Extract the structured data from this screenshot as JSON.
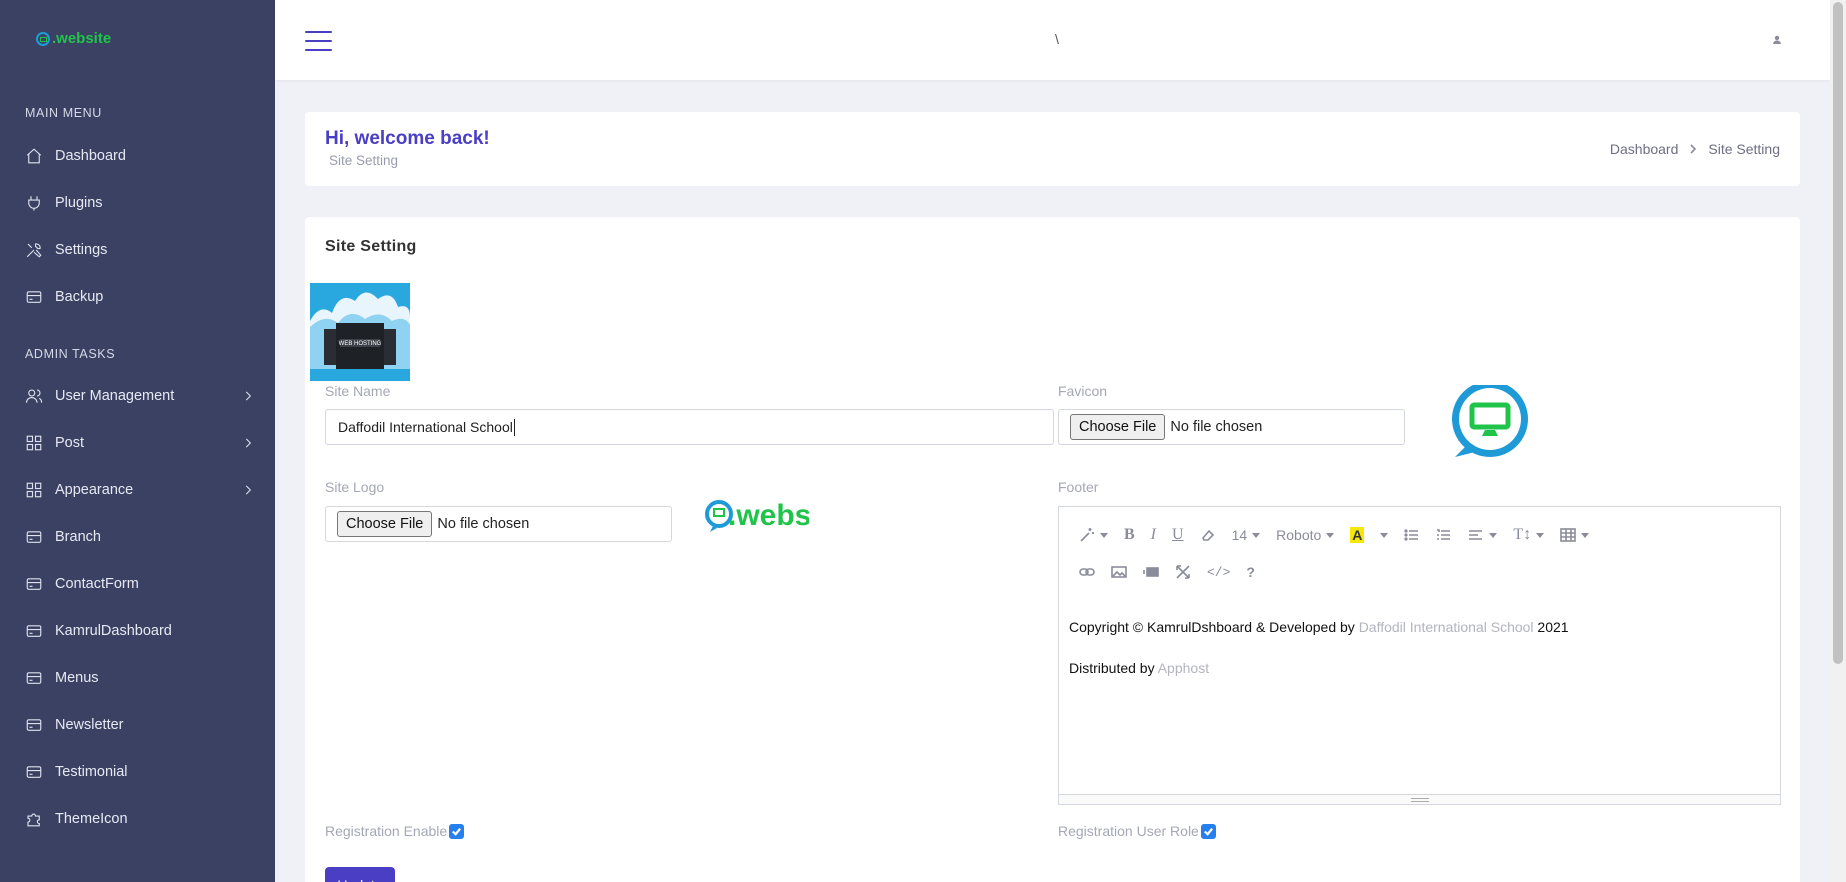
{
  "brand": {
    "name": ".website",
    "accent": "#21c44a"
  },
  "sidebar": {
    "main_heading": "MAIN MENU",
    "main_items": [
      {
        "label": "Dashboard",
        "icon": "home-icon"
      },
      {
        "label": "Plugins",
        "icon": "plug-icon"
      },
      {
        "label": "Settings",
        "icon": "tools-icon"
      },
      {
        "label": "Backup",
        "icon": "card-icon"
      }
    ],
    "admin_heading": "ADMIN TASKS",
    "admin_items": [
      {
        "label": "User Management",
        "icon": "users-icon",
        "expandable": true
      },
      {
        "label": "Post",
        "icon": "grid-icon",
        "expandable": true
      },
      {
        "label": "Appearance",
        "icon": "grid-icon",
        "expandable": true
      },
      {
        "label": "Branch",
        "icon": "card-icon"
      },
      {
        "label": "ContactForm",
        "icon": "card-icon"
      },
      {
        "label": "KamrulDashboard",
        "icon": "card-icon"
      },
      {
        "label": "Menus",
        "icon": "card-icon"
      },
      {
        "label": "Newsletter",
        "icon": "card-icon"
      },
      {
        "label": "Testimonial",
        "icon": "card-icon"
      },
      {
        "label": "ThemeIcon",
        "icon": "puzzle-icon"
      }
    ]
  },
  "topbar": {
    "center_text": "\\"
  },
  "header": {
    "welcome": "Hi, welcome back!",
    "subtitle": "Site Setting",
    "breadcrumb": [
      "Dashboard",
      "Site Setting"
    ]
  },
  "form": {
    "title": "Site Setting",
    "site_name_label": "Site Name",
    "site_name_value": "Daffodil International School",
    "favicon_label": "Favicon",
    "site_logo_label": "Site Logo",
    "file_button": "Choose File",
    "file_status": "No file chosen",
    "footer_label": "Footer",
    "footer_font_size": "14",
    "footer_font_name": "Roboto",
    "footer_line1_prefix": "Copyright © KamrulDshboard & Developed by ",
    "footer_line1_link": "Daffodil International School",
    "footer_line1_suffix": " 2021",
    "footer_line2_prefix": "Distributed by ",
    "footer_line2_link": "Apphost",
    "registration_enable_label": "Registration Enable",
    "registration_enable_checked": true,
    "registration_role_label": "Registration User Role",
    "registration_role_checked": true,
    "update_button": "Update",
    "hosting_image_text": "WEB HOSTING"
  },
  "colors": {
    "sidebar_bg": "#3b4163",
    "primary": "#4a3fc4",
    "checkbox": "#2680eb"
  }
}
